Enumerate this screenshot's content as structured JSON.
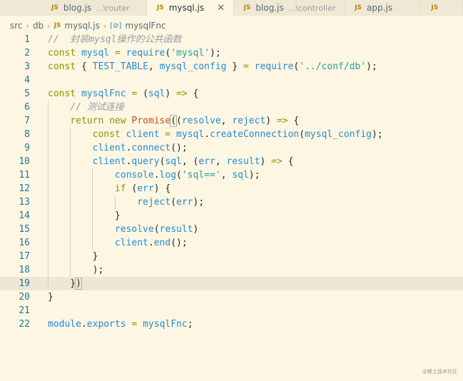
{
  "tabs": [
    {
      "icon": "JS",
      "name": "blog.js",
      "desc": "...\\router",
      "active": false
    },
    {
      "icon": "JS",
      "name": "mysql.js",
      "desc": "",
      "active": true,
      "close": "✕"
    },
    {
      "icon": "JS",
      "name": "blog.js",
      "desc": "...\\controller",
      "active": false
    },
    {
      "icon": "JS",
      "name": "app.js",
      "desc": "",
      "active": false
    },
    {
      "icon": "JS",
      "name": "",
      "desc": "",
      "active": false
    }
  ],
  "breadcrumb": {
    "parts": [
      "src",
      "db"
    ],
    "file_icon": "JS",
    "file": "mysql.js",
    "symbol_icon": "[⊘]",
    "symbol": "mysqlFnc"
  },
  "current_line": 19,
  "lines": [
    {
      "n": "1",
      "tokens": [
        [
          "cm",
          "//  封装mysql操作的公共函数"
        ]
      ]
    },
    {
      "n": "2",
      "tokens": [
        [
          "kw",
          "const "
        ],
        [
          "id",
          "mysql"
        ],
        [
          "op",
          " = "
        ],
        [
          "fn",
          "require"
        ],
        [
          "pl",
          "("
        ],
        [
          "st",
          "'mysql'"
        ],
        [
          "pl",
          ");"
        ]
      ]
    },
    {
      "n": "3",
      "tokens": [
        [
          "kw",
          "const "
        ],
        [
          "pl",
          "{ "
        ],
        [
          "id",
          "TEST_TABLE"
        ],
        [
          "pl",
          ", "
        ],
        [
          "id",
          "mysql_config"
        ],
        [
          "pl",
          " } "
        ],
        [
          "op",
          "= "
        ],
        [
          "fn",
          "require"
        ],
        [
          "pl",
          "("
        ],
        [
          "st",
          "'../conf/db'"
        ],
        [
          "pl",
          ");"
        ]
      ]
    },
    {
      "n": "4",
      "tokens": []
    },
    {
      "n": "5",
      "tokens": [
        [
          "kw",
          "const "
        ],
        [
          "id",
          "mysqlFnc"
        ],
        [
          "op",
          " = "
        ],
        [
          "pl",
          "("
        ],
        [
          "id",
          "sql"
        ],
        [
          "pl",
          ") "
        ],
        [
          "op",
          "=>"
        ],
        [
          "pl",
          " {"
        ]
      ]
    },
    {
      "n": "6",
      "tokens": [
        [
          "pl",
          "    "
        ],
        [
          "cm",
          "// 测试连接"
        ]
      ]
    },
    {
      "n": "7",
      "tokens": [
        [
          "pl",
          "    "
        ],
        [
          "kw",
          "return new "
        ],
        [
          "cls",
          "Promise"
        ],
        [
          "br",
          "("
        ],
        [
          "pl",
          "("
        ],
        [
          "id",
          "resolve"
        ],
        [
          "pl",
          ", "
        ],
        [
          "id",
          "reject"
        ],
        [
          "pl",
          ") "
        ],
        [
          "op",
          "=>"
        ],
        [
          "pl",
          " {"
        ]
      ]
    },
    {
      "n": "8",
      "tokens": [
        [
          "pl",
          "        "
        ],
        [
          "kw",
          "const "
        ],
        [
          "id",
          "client"
        ],
        [
          "op",
          " = "
        ],
        [
          "id",
          "mysql"
        ],
        [
          "pl",
          "."
        ],
        [
          "fn",
          "createConnection"
        ],
        [
          "pl",
          "("
        ],
        [
          "id",
          "mysql_config"
        ],
        [
          "pl",
          ");"
        ]
      ]
    },
    {
      "n": "9",
      "tokens": [
        [
          "pl",
          "        "
        ],
        [
          "id",
          "client"
        ],
        [
          "pl",
          "."
        ],
        [
          "fn",
          "connect"
        ],
        [
          "pl",
          "();"
        ]
      ]
    },
    {
      "n": "10",
      "tokens": [
        [
          "pl",
          "        "
        ],
        [
          "id",
          "client"
        ],
        [
          "pl",
          "."
        ],
        [
          "fn",
          "query"
        ],
        [
          "pl",
          "("
        ],
        [
          "id",
          "sql"
        ],
        [
          "pl",
          ", ("
        ],
        [
          "id",
          "err"
        ],
        [
          "pl",
          ", "
        ],
        [
          "id",
          "result"
        ],
        [
          "pl",
          ") "
        ],
        [
          "op",
          "=>"
        ],
        [
          "pl",
          " {"
        ]
      ]
    },
    {
      "n": "11",
      "tokens": [
        [
          "pl",
          "            "
        ],
        [
          "id",
          "console"
        ],
        [
          "pl",
          "."
        ],
        [
          "fn",
          "log"
        ],
        [
          "pl",
          "("
        ],
        [
          "st",
          "'sql=='"
        ],
        [
          "pl",
          ", "
        ],
        [
          "id",
          "sql"
        ],
        [
          "pl",
          ");"
        ]
      ]
    },
    {
      "n": "12",
      "tokens": [
        [
          "pl",
          "            "
        ],
        [
          "kw",
          "if "
        ],
        [
          "pl",
          "("
        ],
        [
          "id",
          "err"
        ],
        [
          "pl",
          ") {"
        ]
      ]
    },
    {
      "n": "13",
      "tokens": [
        [
          "pl",
          "                "
        ],
        [
          "fn",
          "reject"
        ],
        [
          "pl",
          "("
        ],
        [
          "id",
          "err"
        ],
        [
          "pl",
          ");"
        ]
      ]
    },
    {
      "n": "14",
      "tokens": [
        [
          "pl",
          "            }"
        ]
      ]
    },
    {
      "n": "15",
      "tokens": [
        [
          "pl",
          "            "
        ],
        [
          "fn",
          "resolve"
        ],
        [
          "pl",
          "("
        ],
        [
          "id",
          "result"
        ],
        [
          "pl",
          ")"
        ]
      ]
    },
    {
      "n": "16",
      "tokens": [
        [
          "pl",
          "            "
        ],
        [
          "id",
          "client"
        ],
        [
          "pl",
          "."
        ],
        [
          "fn",
          "end"
        ],
        [
          "pl",
          "();"
        ]
      ]
    },
    {
      "n": "17",
      "tokens": [
        [
          "pl",
          "        }"
        ]
      ]
    },
    {
      "n": "18",
      "tokens": [
        [
          "pl",
          "        );"
        ]
      ]
    },
    {
      "n": "19",
      "tokens": [
        [
          "pl",
          "    }"
        ],
        [
          "br",
          ")"
        ]
      ]
    },
    {
      "n": "20",
      "tokens": [
        [
          "pl",
          "}"
        ]
      ]
    },
    {
      "n": "21",
      "tokens": []
    },
    {
      "n": "22",
      "tokens": [
        [
          "id",
          "module"
        ],
        [
          "pl",
          "."
        ],
        [
          "id",
          "exports"
        ],
        [
          "op",
          " = "
        ],
        [
          "id",
          "mysqlFnc"
        ],
        [
          "pl",
          ";"
        ]
      ]
    }
  ],
  "watermark": "@稀土技术社区",
  "colors": {
    "background": "#fdf6e3",
    "keyword": "#859900",
    "identifier": "#268bd2",
    "string": "#2aa198",
    "comment": "#93a1a1",
    "class": "#cb4b16",
    "line_number": "#237893"
  }
}
